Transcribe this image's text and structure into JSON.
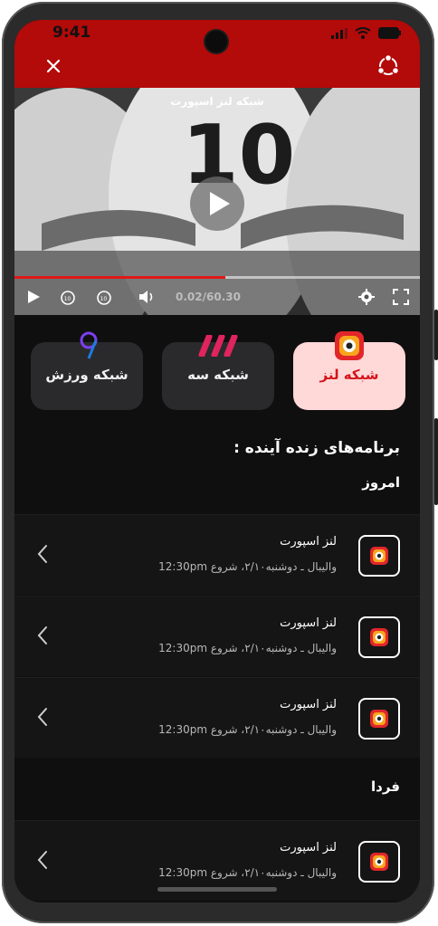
{
  "status_bar": {
    "time": "9:41"
  },
  "header": {
    "close_icon": "close-icon",
    "share_icon": "share-icon"
  },
  "player": {
    "channel_title": "شبکه لنز اسپورت",
    "time_display": "0.02/60.30",
    "progress": 0.52,
    "colors": {
      "progress": "#e01818",
      "header": "#b30a0a"
    }
  },
  "channels": [
    {
      "label": "شبکه لنز",
      "selected": true,
      "icon": "lenz-logo"
    },
    {
      "label": "شبکه سه",
      "selected": false,
      "icon": "seh-logo"
    },
    {
      "label": "شبکه ورزش",
      "selected": false,
      "icon": "varzesh-logo"
    }
  ],
  "schedule": {
    "heading": "برنامه‌های زنده آینده :",
    "today_label": "امروز",
    "tomorrow_label": "فردا",
    "today": [
      {
        "title": "لنز اسپورت",
        "subtitle": "والیبال ـ دوشنبه۲/۱۰، شروع 12:30pm"
      },
      {
        "title": "لنز اسپورت",
        "subtitle": "والیبال ـ دوشنبه۲/۱۰، شروع 12:30pm"
      },
      {
        "title": "لنز اسپورت",
        "subtitle": "والیبال ـ دوشنبه۲/۱۰، شروع 12:30pm"
      }
    ],
    "tomorrow": [
      {
        "title": "لنز اسپورت",
        "subtitle": "والیبال ـ دوشنبه۲/۱۰، شروع 12:30pm"
      }
    ]
  }
}
